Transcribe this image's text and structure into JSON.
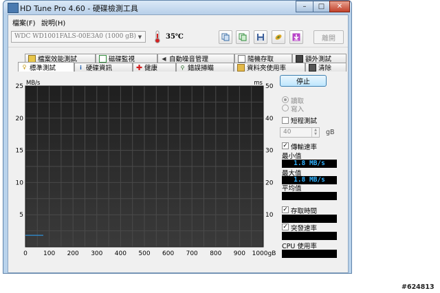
{
  "window": {
    "title": "HD Tune Pro 4.60 - 硬碟檢測工具",
    "minimize": "–",
    "maximize": "□",
    "close": "✕"
  },
  "menu": [
    "檔案(F)",
    "說明(H)"
  ],
  "toolbar": {
    "drive": "WDC WD1001FALS-00E3A0 (1000 gB)",
    "temperature": "35℃",
    "icons": [
      "copy-icon",
      "copy-alt-icon",
      "save-icon",
      "health-icon",
      "download-icon"
    ],
    "exit_label": "離開"
  },
  "tabs_top": [
    "檔案效能測試",
    "磁碟監視",
    "自動噪音管理",
    "隨機存取",
    "額外測試"
  ],
  "tabs_bottom": [
    "標準測試",
    "硬碟資訊",
    "健康",
    "錯誤掃瞄",
    "資料夾使用率",
    "清除"
  ],
  "chart_data": {
    "type": "line",
    "ylabel_left": "MB/s",
    "ylabel_right": "ms",
    "y_left_ticks": [
      "25",
      "20",
      "15",
      "10",
      "5"
    ],
    "y_right_ticks": [
      "50",
      "40",
      "30",
      "20",
      "10"
    ],
    "x_ticks": [
      "0",
      "100",
      "200",
      "300",
      "400",
      "500",
      "600",
      "700",
      "800",
      "900",
      "1000gB"
    ],
    "y_left_range": [
      0,
      25
    ],
    "y_right_range": [
      0,
      50
    ],
    "x_range": [
      0,
      1000
    ],
    "grid": true,
    "series": [
      {
        "color": "#2f8fd8",
        "x": [
          0,
          75
        ],
        "y": [
          1.8,
          1.8
        ]
      }
    ]
  },
  "right_panel": {
    "stop_label": "停止",
    "read_label": "讀取",
    "write_label": "寫入",
    "short_test_label": "短程測試",
    "short_value": "40",
    "short_unit": "gB",
    "transfer_label": "傳輸速率",
    "min_label": "最小值",
    "min_value": "1.8 MB/s",
    "max_label": "最大值",
    "max_value": "1.8 MB/s",
    "avg_label": "平均值",
    "avg_value": "",
    "access_label": "存取時間",
    "access_value": "",
    "burst_label": "突發速率",
    "burst_value": "",
    "cpu_label": "CPU 使用率",
    "cpu_value": ""
  },
  "watermark": "#624813"
}
